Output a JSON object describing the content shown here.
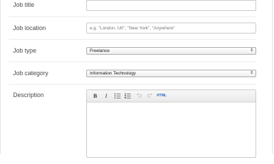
{
  "form": {
    "job_title": {
      "label": "Job title",
      "value": "",
      "placeholder": ""
    },
    "job_location": {
      "label": "Job location",
      "value": "",
      "placeholder": "e.g. \"London, UK\", \"New York\", \"Anywhere\""
    },
    "job_type": {
      "label": "Job type",
      "selected": "Freelance"
    },
    "job_category": {
      "label": "Job category",
      "selected": "Information Technology"
    },
    "description": {
      "label": "Description",
      "toolbar": {
        "bold": "B",
        "italic": "I",
        "bulleted_list_icon": "bulleted-list-icon",
        "numbered_list_icon": "numbered-list-icon",
        "undo_icon": "undo-icon",
        "redo_icon": "redo-icon",
        "html": "HTML"
      }
    }
  }
}
